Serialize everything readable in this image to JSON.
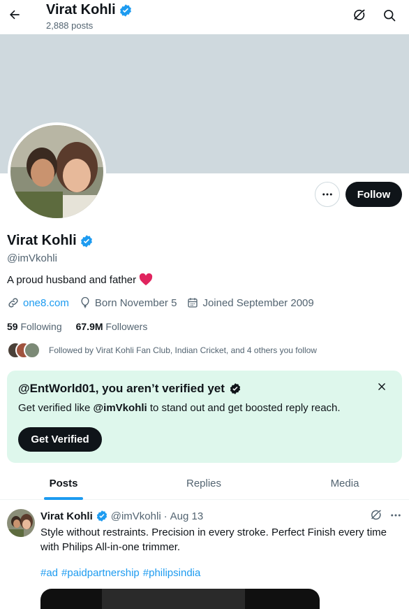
{
  "header": {
    "title": "Virat Kohli",
    "posts_count": "2,888 posts"
  },
  "profile": {
    "name": "Virat Kohli",
    "handle": "@imVkohli",
    "bio": "A proud husband and father",
    "website": "one8.com",
    "birthday": "Born November 5",
    "joined": "Joined September 2009",
    "following_count": "59",
    "following_label": "Following",
    "followers_count": "67.9M",
    "followers_label": "Followers",
    "followed_by": "Followed by Virat Kohli Fan Club, Indian Cricket, and 4 others you follow",
    "follow_label": "Follow"
  },
  "verify_card": {
    "title": "@EntWorld01, you aren’t verified yet",
    "text_prefix": "Get verified like ",
    "text_handle": "@imVkohli",
    "text_suffix": " to stand out and get boosted reply reach.",
    "button_label": "Get Verified"
  },
  "tabs": [
    {
      "label": "Posts",
      "active": true
    },
    {
      "label": "Replies",
      "active": false
    },
    {
      "label": "Media",
      "active": false
    }
  ],
  "post": {
    "author_name": "Virat Kohli",
    "author_handle": "@imVkohli",
    "separator": "·",
    "date": "Aug 13",
    "text": "Style without restraints. Precision in every stroke. Perfect Finish every time with Philips All-in-one trimmer.",
    "hashtags": [
      "#ad",
      "#paidpartnership",
      "#philipsindia"
    ]
  },
  "colors": {
    "accent": "#1d9bf0",
    "verified_badge": "#1d9bf0",
    "banner": "#cfd9de",
    "card_bg": "#def7ec",
    "heart": "#f91880"
  }
}
